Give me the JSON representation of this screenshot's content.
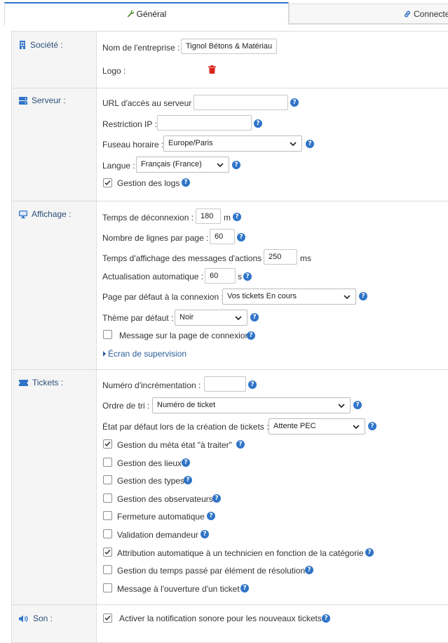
{
  "tabs": {
    "general": "Général",
    "connecteurs": "Connecteurs"
  },
  "colors": {
    "accent": "#2f74c8",
    "delete_icon": "#d9251d",
    "section_title": "#2b4f7a"
  },
  "societe": {
    "title": "Société :",
    "nom_label": "Nom de l'entreprise :",
    "nom_value": "Tignol Bétons & Matériau",
    "logo_label": "Logo :"
  },
  "serveur": {
    "title": "Serveur :",
    "url_label": "URL d'accès au serveur :",
    "url_value": "",
    "ip_label": "Restriction IP :",
    "ip_value": "",
    "fuseau_label": "Fuseau horaire :",
    "fuseau_value": "Europe/Paris",
    "langue_label": "Langue :",
    "langue_value": "Français (France)",
    "logs_label": "Gestion des logs",
    "logs_checked": true
  },
  "affichage": {
    "title": "Affichage :",
    "deconnexion_label": "Temps de déconnexion :",
    "deconnexion_value": "180",
    "deconnexion_unit": "m",
    "lignes_label": "Nombre de lignes par page :",
    "lignes_value": "60",
    "messages_label": "Temps d'affichage des messages d'actions :",
    "messages_value": "250",
    "messages_unit": "ms",
    "actualisation_label": "Actualisation automatique :",
    "actualisation_value": "60",
    "actualisation_unit": "s",
    "page_label": "Page par défaut à la connexion :",
    "page_value": "Vos tickets En cours",
    "theme_label": "Thème par défaut :",
    "theme_value": "Noir",
    "message_connexion_label": "Message sur la page de connexion",
    "message_connexion_checked": false,
    "supervision_label": "Écran de supervision"
  },
  "tickets": {
    "title": "Tickets :",
    "increment_label": "Numéro d'incrémentation :",
    "increment_value": "",
    "tri_label": "Ordre de tri :",
    "tri_value": "Numéro de ticket",
    "etat_label": "État par défaut lors de la création de tickets :",
    "etat_value": "Attente PEC",
    "options": [
      {
        "label": "Gestion du méta état \"à traiter\"",
        "checked": true
      },
      {
        "label": "Gestion des lieux",
        "checked": false
      },
      {
        "label": "Gestion des types",
        "checked": false
      },
      {
        "label": "Gestion des observateurs",
        "checked": false
      },
      {
        "label": "Fermeture automatique",
        "checked": false
      },
      {
        "label": "Validation demandeur",
        "checked": false
      },
      {
        "label": "Attribution automatique à un technicien en fonction de la catégorie",
        "checked": true
      },
      {
        "label": "Gestion du temps passé par élément de résolution",
        "checked": false
      },
      {
        "label": "Message à l'ouverture d'un ticket",
        "checked": false
      }
    ]
  },
  "son": {
    "title": "Son :",
    "notif_label": "Activer la notification sonore pour les nouveaux tickets",
    "notif_checked": true
  }
}
